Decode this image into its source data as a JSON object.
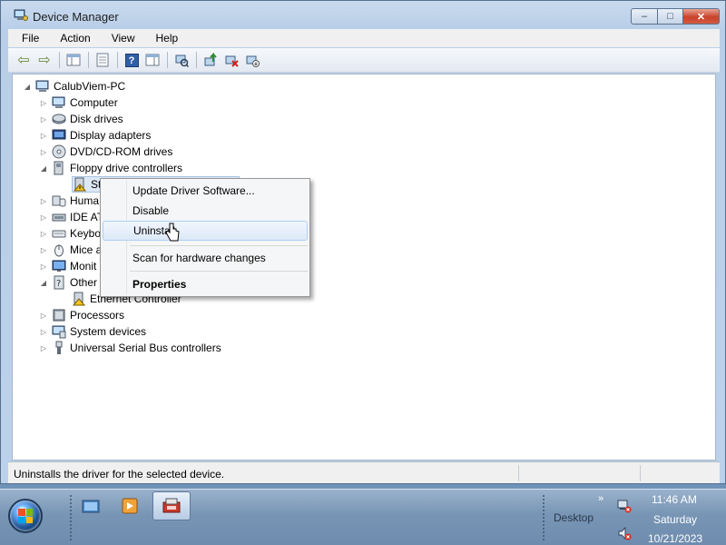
{
  "window": {
    "title": "Device Manager",
    "minimize_glyph": "–",
    "maximize_glyph": "□",
    "close_glyph": "✕"
  },
  "menubar": [
    "File",
    "Action",
    "View",
    "Help"
  ],
  "toolbar": {
    "back_glyph": "⇦",
    "forward_glyph": "⇨",
    "help_glyph": "?"
  },
  "tree": {
    "root": "CalubViem-PC",
    "nodes": [
      {
        "label": "Computer",
        "expanded": false
      },
      {
        "label": "Disk drives",
        "expanded": false
      },
      {
        "label": "Display adapters",
        "expanded": false
      },
      {
        "label": "DVD/CD-ROM drives",
        "expanded": false
      },
      {
        "label": "Floppy drive controllers",
        "expanded": true
      },
      {
        "label": "Sta",
        "child": true
      },
      {
        "label": "Huma",
        "expanded": false
      },
      {
        "label": "IDE AT",
        "expanded": false
      },
      {
        "label": "Keybo",
        "expanded": false
      },
      {
        "label": "Mice a",
        "expanded": false
      },
      {
        "label": "Monit",
        "expanded": false
      },
      {
        "label": "Other",
        "expanded": true
      },
      {
        "label": "Ethernet Controller",
        "child": true
      },
      {
        "label": "Processors",
        "expanded": false
      },
      {
        "label": "System devices",
        "expanded": false
      },
      {
        "label": "Universal Serial Bus controllers",
        "expanded": false
      }
    ]
  },
  "context_menu": {
    "items": [
      "Update Driver Software...",
      "Disable",
      "Uninstall",
      "Scan for hardware changes",
      "Properties"
    ]
  },
  "statusbar": {
    "text": "Uninstalls the driver for the selected device."
  },
  "taskbar": {
    "desktop_label": "Desktop",
    "tray_expand": "»",
    "time": "11:46 AM",
    "day": "Saturday",
    "date": "10/21/2023"
  }
}
